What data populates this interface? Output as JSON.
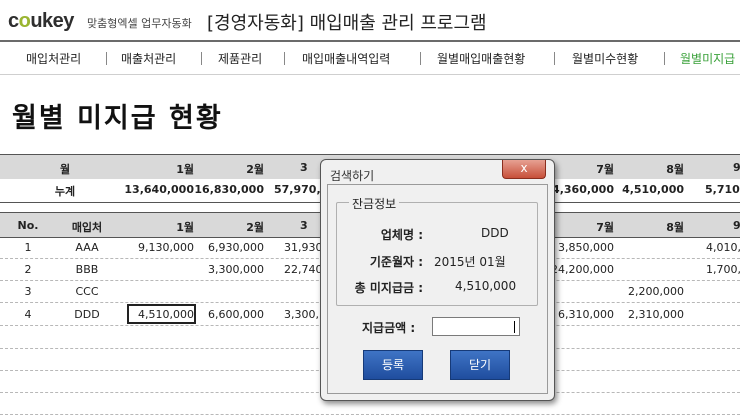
{
  "logo": {
    "brand_a": "c",
    "brand_o": "o",
    "brand_b": "ukey",
    "sub": "맞춤형엑셀 업무자동화"
  },
  "app_title": "[경영자동화] 매입매출 관리 프로그램",
  "nav": [
    "매입처관리",
    "매출처관리",
    "제품관리",
    "매입매출내역입력",
    "월별매입매출현황",
    "월별미수현황",
    "월별미지급"
  ],
  "page_title": "월별 미지급 현황",
  "summary": {
    "header": [
      "월",
      "1월",
      "2월",
      "3",
      "7월",
      "8월",
      "9"
    ],
    "total_label": "누계",
    "totals": [
      "13,640,000",
      "16,830,000",
      "57,970,",
      "34,360,000",
      "4,510,000",
      "5,710,0"
    ]
  },
  "table": {
    "columns": [
      "No.",
      "매입처",
      "1월",
      "2월",
      "3",
      "7월",
      "8월",
      "9"
    ],
    "rows": [
      [
        "1",
        "AAA",
        "9,130,000",
        "6,930,000",
        "31,930,",
        "3,850,000",
        "",
        "4,010,0"
      ],
      [
        "2",
        "BBB",
        "",
        "3,300,000",
        "22,740,",
        "24,200,000",
        "",
        "1,700,0"
      ],
      [
        "3",
        "CCC",
        "",
        "",
        "",
        "",
        "2,200,000",
        ""
      ],
      [
        "4",
        "DDD",
        "4,510,000",
        "6,600,000",
        "3,300,",
        "6,310,000",
        "2,310,000",
        ""
      ]
    ]
  },
  "dialog": {
    "title": "검색하기",
    "close": "x",
    "group_title": "잔금정보",
    "vendor_label": "업체명 :",
    "vendor_value": "DDD",
    "month_label": "기준월자 :",
    "month_value": "2015년 01월",
    "unpaid_label": "총 미지급금 :",
    "unpaid_value": "4,510,000",
    "pay_label": "지급금액 :",
    "pay_value": "",
    "register_btn": "등록",
    "close_btn": "닫기"
  }
}
